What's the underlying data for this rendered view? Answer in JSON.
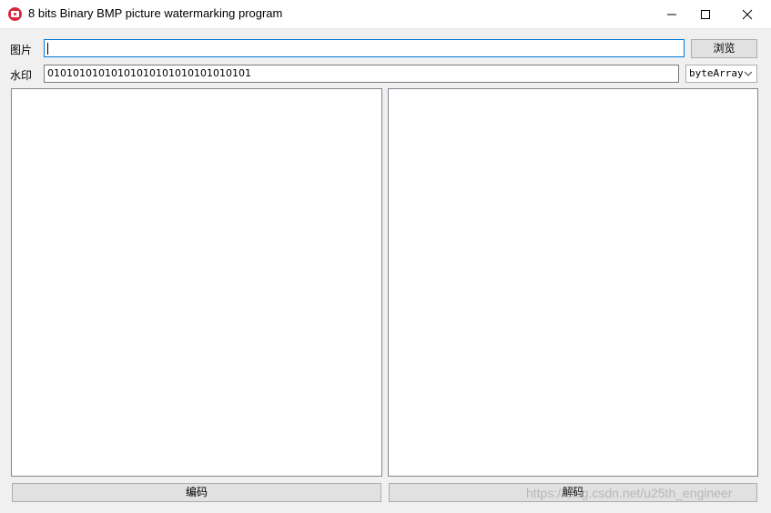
{
  "window": {
    "title": "8 bits Binary BMP picture watermarking program",
    "icon": "camera-icon",
    "controls": [
      "minimize-icon",
      "maximize-icon",
      "close-icon"
    ]
  },
  "image_row": {
    "label": "图片",
    "value": "",
    "browse_label": "浏览"
  },
  "watermark_row": {
    "label": "水印",
    "value": "01010101010101010101010101010101",
    "format_selected": "byteArray"
  },
  "actions": {
    "encode_label": "编码",
    "decode_label": "解码"
  },
  "overlay": {
    "watermark_text": "https://blog.csdn.net/u25th_engineer"
  }
}
